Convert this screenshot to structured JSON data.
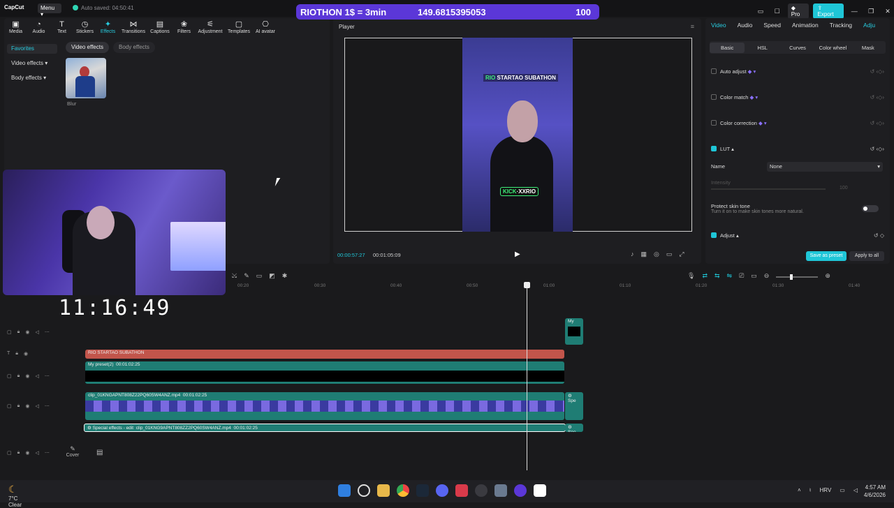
{
  "titlebar": {
    "logo": "CapCut",
    "menu": "Menu",
    "autosave": "Auto saved: 04:50:41",
    "pro": "Pro",
    "export": "Export"
  },
  "overlay": {
    "label": "RIOTHON 1$ = 3min",
    "value": "149.6815395053",
    "count": "100",
    "clock": "11:16:49"
  },
  "toolbar": {
    "items": [
      "Media",
      "Audio",
      "Text",
      "Stickers",
      "Effects",
      "Transitions",
      "Captions",
      "Filters",
      "Adjustment",
      "Templates",
      "AI avatar"
    ],
    "active": "Effects"
  },
  "effects": {
    "sidebar": [
      "Favorites",
      "Video effects",
      "Body effects"
    ],
    "tabs": [
      "Video effects",
      "Body effects"
    ],
    "thumb_label": "Blur"
  },
  "player": {
    "title": "Player",
    "caption_green": "RIO",
    "caption_white": "STARTAO SUBATHON",
    "caption2_green": "KICK",
    "caption2_white": "XXRIO",
    "current_time": "00:00:57:27",
    "total_time": "00:01:05:09"
  },
  "inspector": {
    "tabs": [
      "Video",
      "Audio",
      "Speed",
      "Animation",
      "Tracking",
      "Adju"
    ],
    "active_tab": "Video",
    "subtabs": [
      "Basic",
      "HSL",
      "Curves",
      "Color wheel",
      "Mask"
    ],
    "active_subtab": "Basic",
    "auto_adjust": "Auto adjust",
    "color_match": "Color match",
    "color_correction": "Color correction",
    "lut": "LUT",
    "name_label": "Name",
    "name_value": "None",
    "intensity": "Intensity",
    "intensity_value": "100",
    "protect_title": "Protect skin tone",
    "protect_desc": "Turn it on to make skin tones more natural.",
    "adjust": "Adjust",
    "save_preset": "Save as preset",
    "apply_all": "Apply to all"
  },
  "timeline": {
    "ticks": [
      "00:20",
      "00:30",
      "00:40",
      "00:50",
      "01:00",
      "01:10",
      "01:20",
      "01:30",
      "01:40"
    ],
    "text_clip": "RIO STARTAO SUBATHON",
    "preset_clip": "My preset(2)",
    "preset_dur": "00:01:02:25",
    "video_clip": "clip_01KNGAPNT808Z22PQ60SW4ANZ.mp4",
    "video_dur": "00:01:02:25",
    "effect_clip": "Special effects - edit",
    "effect_clip2": "clip_01KNG9APNT808ZZ2PQ60SW4ANZ.mp4",
    "effect_dur": "00:01:02:25",
    "small_clip": "My",
    "spe": "Spe",
    "cover": "Cover"
  },
  "taskbar": {
    "temp": "7°C",
    "weather": "Clear",
    "lang": "HRV",
    "time": "4:57 AM",
    "date": "4/6/2026"
  }
}
